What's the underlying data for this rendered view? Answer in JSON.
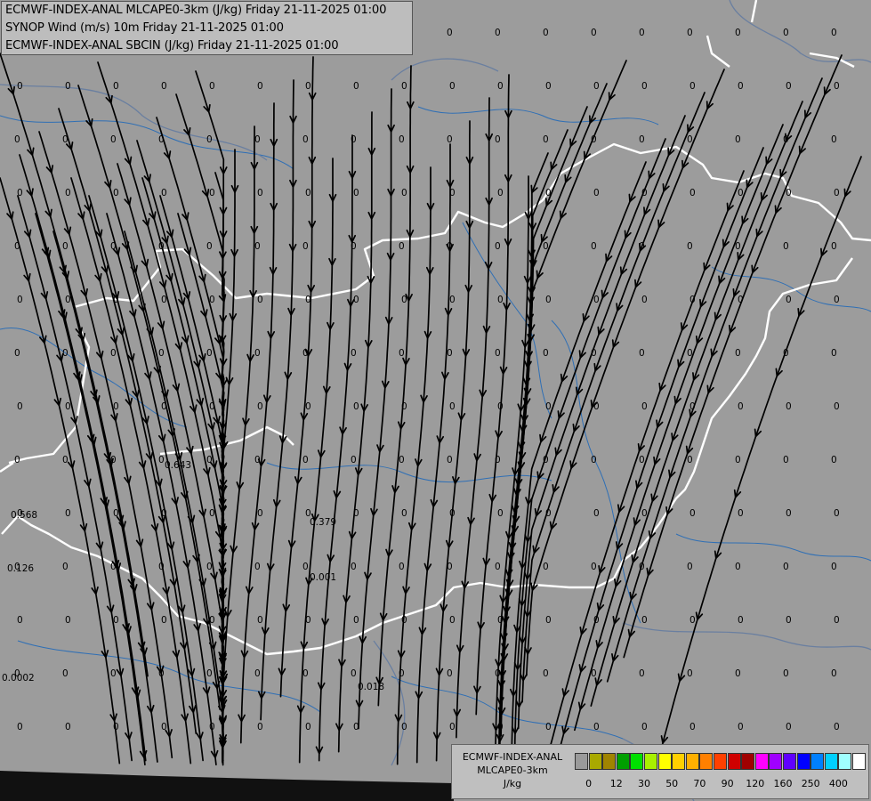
{
  "header": {
    "line1": "ECMWF-INDEX-ANAL MLCAPE0-3km (J/kg) Friday 21-11-2025 01:00",
    "line2": "SYNOP Wind (m/s) 10m Friday 21-11-2025 01:00",
    "line3": "ECMWF-INDEX-ANAL SBCIN (J/kg) Friday 21-11-2025 01:00"
  },
  "legend": {
    "title1": "ECMWF-INDEX-ANAL",
    "title2": "MLCAPE0-3km",
    "unit": "J/kg",
    "colors": [
      "#9a9a9a",
      "#a9a900",
      "#a08400",
      "#00a000",
      "#00e000",
      "#a8f000",
      "#ffff00",
      "#ffd000",
      "#ffb000",
      "#ff8000",
      "#ff4000",
      "#d00000",
      "#a00000",
      "#ff00ff",
      "#a000ff",
      "#6000ff",
      "#0000ff",
      "#0080ff",
      "#00d0ff",
      "#a0ffff",
      "#ffffff"
    ],
    "ticks": [
      "0",
      "12",
      "30",
      "50",
      "70",
      "90",
      "120",
      "160",
      "250",
      "400"
    ]
  },
  "values": {
    "zero": "0",
    "v1": "0.643",
    "v2": "0.568",
    "v3": "0.379",
    "v4": "0.126",
    "v5": "0.001",
    "v6": "0.0002",
    "v7": "0.018"
  }
}
